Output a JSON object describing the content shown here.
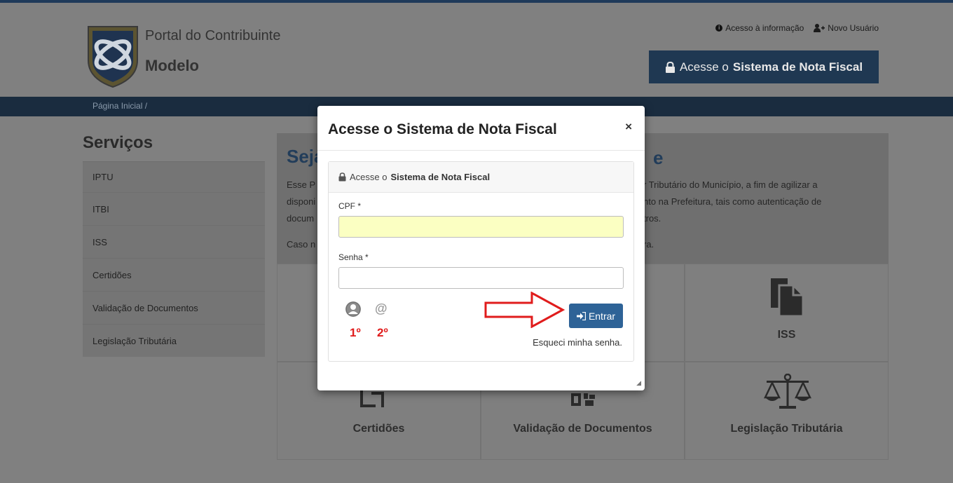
{
  "header": {
    "brand_line1": "Portal do Contribuinte",
    "brand_line2": "Modelo",
    "link_info": "Acesso à informação",
    "link_new_user": "Novo Usuário",
    "system_button_prefix": "Acesse o",
    "system_button_bold": "Sistema de Nota Fiscal"
  },
  "breadcrumb": "Página Inicial  /",
  "sidebar": {
    "title": "Serviços",
    "items": [
      {
        "label": "IPTU"
      },
      {
        "label": "ITBI"
      },
      {
        "label": "ISS"
      },
      {
        "label": "Certidões"
      },
      {
        "label": "Validação de Documentos"
      },
      {
        "label": "Legislação Tributária"
      }
    ]
  },
  "welcome": {
    "title_left": "Seja",
    "title_right": "e",
    "left_lines": [
      "Esse P",
      "disponi",
      "docum",
      "Caso n"
    ],
    "right_lines": [
      "r Tributário do Município, a fim de agilizar a",
      "nto na Prefeitura, tais como autenticação de",
      "tros.",
      "ra."
    ]
  },
  "tiles": {
    "iss": "ISS",
    "certidoes": "Certidões",
    "validacao": "Validação de Documentos",
    "legislacao": "Legislação Tributária"
  },
  "modal": {
    "title": "Acesse o Sistema de Nota Fiscal",
    "close": "×",
    "panel_prefix": "Acesse o",
    "panel_bold": "Sistema de Nota Fiscal",
    "cpf_label": "CPF *",
    "cpf_value": "",
    "password_label": "Senha *",
    "password_value": "",
    "first_label": "1º",
    "second_label": "2º",
    "enter_label": "Entrar",
    "forgot_label": "Esqueci minha senha."
  },
  "colors": {
    "brand_dark": "#1f3852",
    "enter_button": "#2e6397",
    "annotation_red": "#e01c1c",
    "cpf_field": "#fbffc2"
  }
}
